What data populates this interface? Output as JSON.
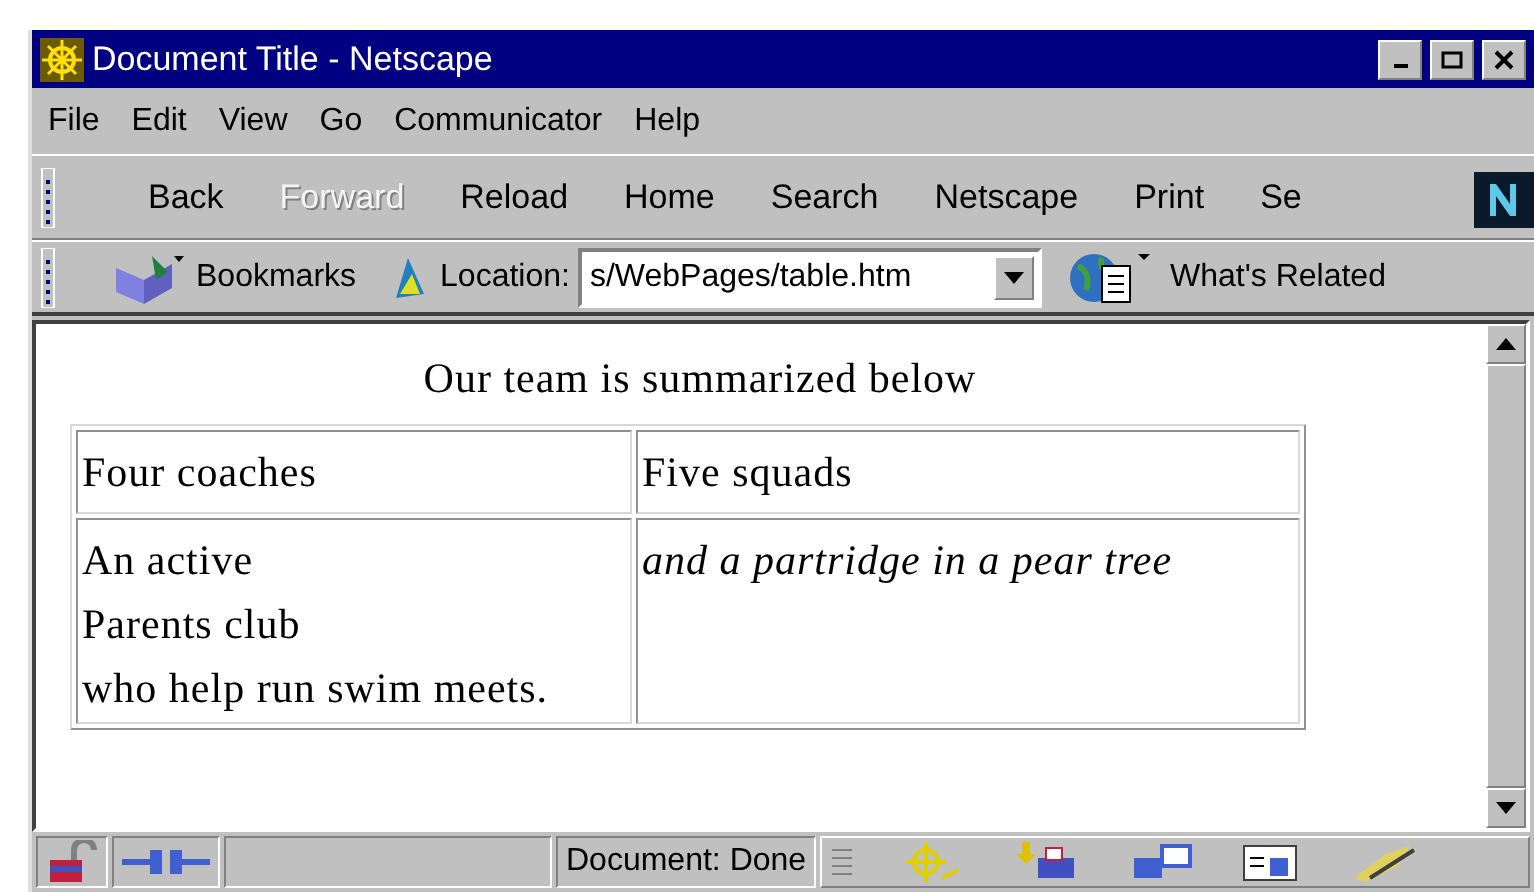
{
  "window": {
    "title": "Document Title - Netscape"
  },
  "menu": [
    {
      "label": "File"
    },
    {
      "label": "Edit"
    },
    {
      "label": "View"
    },
    {
      "label": "Go"
    },
    {
      "label": "Communicator"
    },
    {
      "label": "Help"
    }
  ],
  "toolbar": [
    {
      "label": "Back",
      "disabled": false
    },
    {
      "label": "Forward",
      "disabled": true
    },
    {
      "label": "Reload",
      "disabled": false
    },
    {
      "label": "Home",
      "disabled": false
    },
    {
      "label": "Search",
      "disabled": false
    },
    {
      "label": "Netscape",
      "disabled": false
    },
    {
      "label": "Print",
      "disabled": false
    },
    {
      "label": "Se",
      "disabled": false
    }
  ],
  "location_bar": {
    "bookmarks": "Bookmarks",
    "location_label": "Location:",
    "url": "s/WebPages/table.htm",
    "related": "What's Related"
  },
  "page": {
    "heading": "Our team is summarized below",
    "rows": [
      [
        {
          "lines": [
            "Four coaches"
          ],
          "italic": false
        },
        {
          "lines": [
            "Five squads"
          ],
          "italic": false
        }
      ],
      [
        {
          "lines": [
            "An active",
            "Parents club",
            "who help run swim meets."
          ],
          "italic": false
        },
        {
          "lines": [
            "and a partridge in a pear tree"
          ],
          "italic": true
        }
      ]
    ]
  },
  "status_bar": {
    "text": "Document: Done"
  }
}
